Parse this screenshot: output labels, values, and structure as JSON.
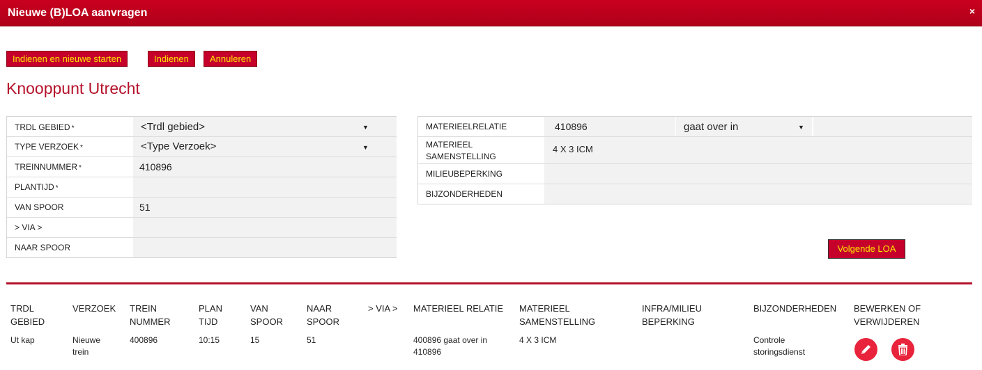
{
  "dialog": {
    "title": "Nieuwe (B)LOA aanvragen",
    "close_glyph": "×"
  },
  "toolbar": {
    "submit_new_label": "Indienen en nieuwe starten",
    "submit_label": "Indienen",
    "cancel_label": "Annuleren"
  },
  "heading": "Knooppunt Utrecht",
  "form_left": {
    "trdl_gebied": {
      "label": "TRDL GEBIED",
      "value": "<Trdl gebied>"
    },
    "type_verzoek": {
      "label": "TYPE VERZOEK",
      "value": "<Type Verzoek>"
    },
    "treinnummer": {
      "label": "TREINNUMMER",
      "value": "410896"
    },
    "plantijd": {
      "label": "PLANTIJD",
      "value": ""
    },
    "van_spoor": {
      "label": "VAN SPOOR",
      "value": "51"
    },
    "via": {
      "label": "> VIA >",
      "value": ""
    },
    "naar_spoor": {
      "label": "NAAR SPOOR",
      "value": ""
    },
    "required_mark": "*"
  },
  "form_right": {
    "materieelrelatie": {
      "label": "MATERIEELRELATIE",
      "value": "410896",
      "relation": "gaat over in",
      "extra": ""
    },
    "materieel_samenstelling": {
      "label_line1": "MATERIEEL",
      "label_line2": "SAMENSTELLING",
      "value": "4 X 3 ICM"
    },
    "milieubeperking": {
      "label": "MILIEUBEPERKING",
      "value": ""
    },
    "bijzonderheden": {
      "label": "BIJZONDERHEDEN",
      "value": ""
    }
  },
  "next_button_label": "Volgende LOA",
  "table": {
    "headers": [
      {
        "l1": "TRDL",
        "l2": "GEBIED"
      },
      {
        "l1": "VERZOEK",
        "l2": ""
      },
      {
        "l1": "TREIN",
        "l2": "NUMMER"
      },
      {
        "l1": "PLAN",
        "l2": "TIJD"
      },
      {
        "l1": "VAN",
        "l2": "SPOOR"
      },
      {
        "l1": "NAAR",
        "l2": "SPOOR"
      },
      {
        "l1": "> VIA >",
        "l2": ""
      },
      {
        "l1": "MATERIEEL RELATIE",
        "l2": ""
      },
      {
        "l1": "MATERIEEL",
        "l2": "SAMENSTELLING"
      },
      {
        "l1": "INFRA/MILIEU",
        "l2": "BEPERKING"
      },
      {
        "l1": "BIJZONDERHEDEN",
        "l2": ""
      },
      {
        "l1": "BEWERKEN OF",
        "l2": "VERWIJDEREN"
      }
    ],
    "rows": [
      {
        "trdl_gebied": "Ut kap",
        "verzoek_l1": "Nieuwe",
        "verzoek_l2": "trein",
        "trein_nummer": "400896",
        "plan_tijd": "10:15",
        "van_spoor": "15",
        "naar_spoor": "51",
        "via": "",
        "materieel_relatie_l1": "400896 gaat over in",
        "materieel_relatie_l2": "410896",
        "materieel_samenstelling": "4 X 3 ICM",
        "infra_milieu": "",
        "bijzonderheden_l1": "Controle",
        "bijzonderheden_l2": "storingsdienst",
        "edit_icon": "pencil-icon",
        "delete_icon": "trash-icon"
      }
    ]
  },
  "colors": {
    "brand_red": "#c5002a",
    "button_text": "#ffe600",
    "heading_red": "#b5122b",
    "icon_red": "#e8233b"
  }
}
